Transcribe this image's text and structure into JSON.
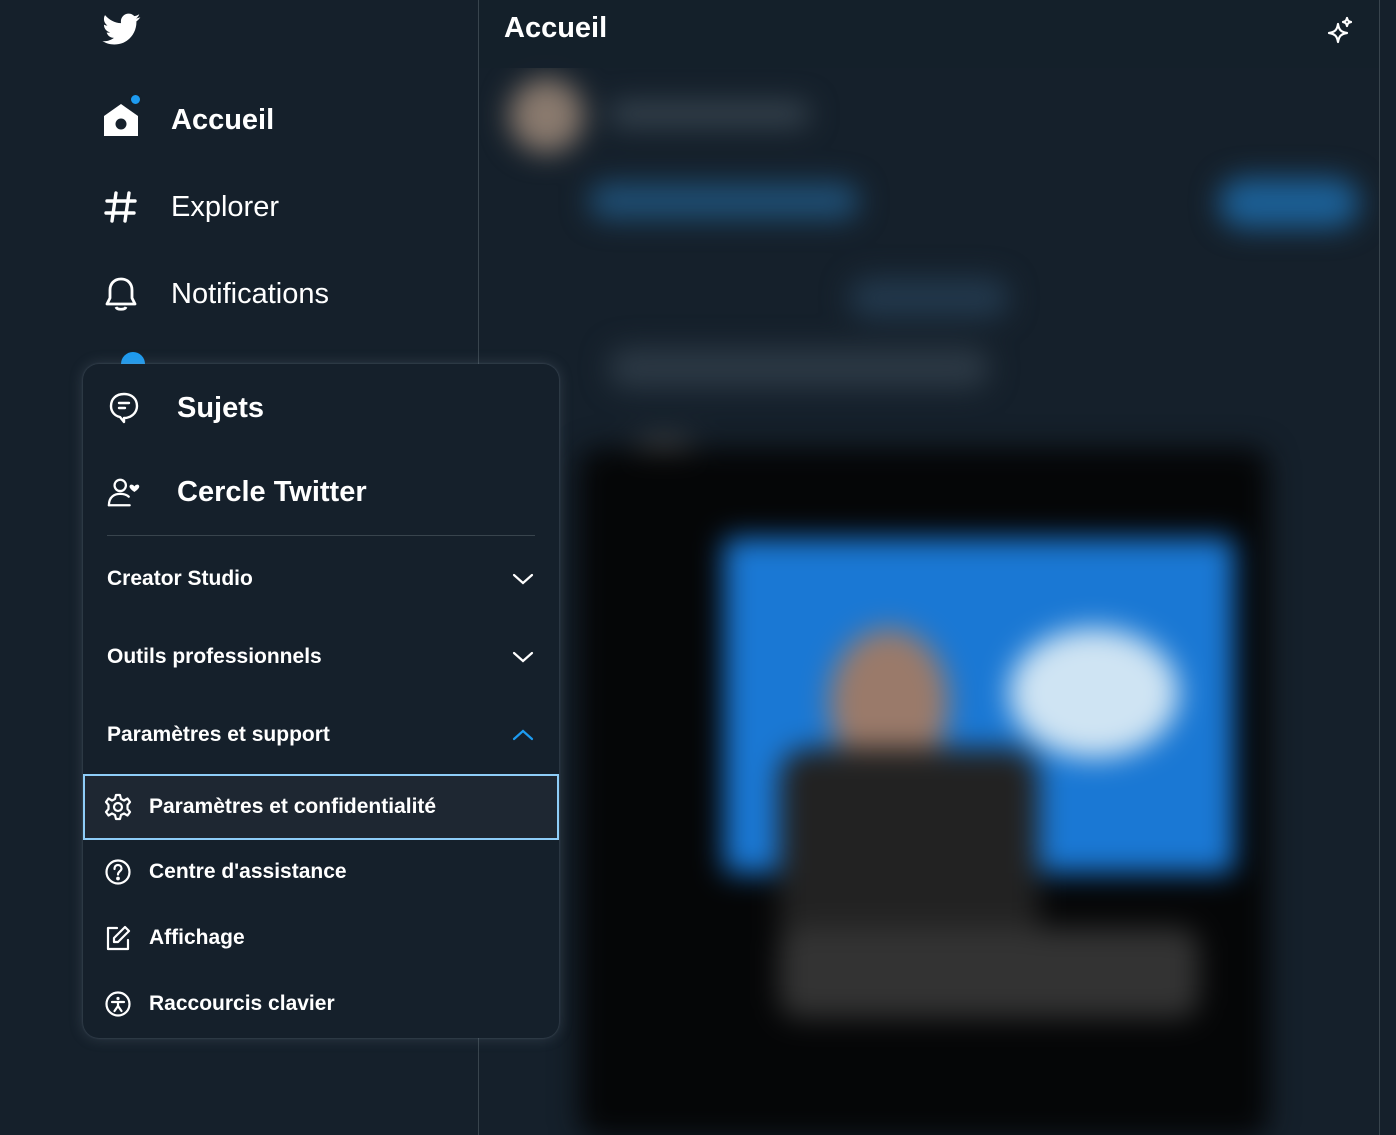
{
  "app": {
    "name": "Twitter"
  },
  "colors": {
    "background": "#15202b",
    "accent": "#1d9bf0",
    "border": "#38444d",
    "focus_ring": "#8ecdf8"
  },
  "nav": {
    "items": [
      {
        "label": "Accueil",
        "icon": "home-icon",
        "active": true
      },
      {
        "label": "Explorer",
        "icon": "hashtag-icon",
        "active": false
      },
      {
        "label": "Notifications",
        "icon": "bell-icon",
        "active": false
      }
    ]
  },
  "main": {
    "title": "Accueil",
    "sparkle_icon": "sparkle-icon"
  },
  "menu": {
    "primary": [
      {
        "label": "Sujets",
        "icon": "topics-icon"
      },
      {
        "label": "Cercle Twitter",
        "icon": "twitter-circle-icon"
      }
    ],
    "sections": [
      {
        "label": "Creator Studio",
        "expanded": false
      },
      {
        "label": "Outils professionnels",
        "expanded": false
      },
      {
        "label": "Paramètres et support",
        "expanded": true
      }
    ],
    "support_items": [
      {
        "label": "Paramètres et confidentialité",
        "icon": "gear-icon",
        "focused": true
      },
      {
        "label": "Centre d'assistance",
        "icon": "help-icon",
        "focused": false
      },
      {
        "label": "Affichage",
        "icon": "edit-display-icon",
        "focused": false
      },
      {
        "label": "Raccourcis clavier",
        "icon": "accessibility-icon",
        "focused": false
      }
    ]
  }
}
